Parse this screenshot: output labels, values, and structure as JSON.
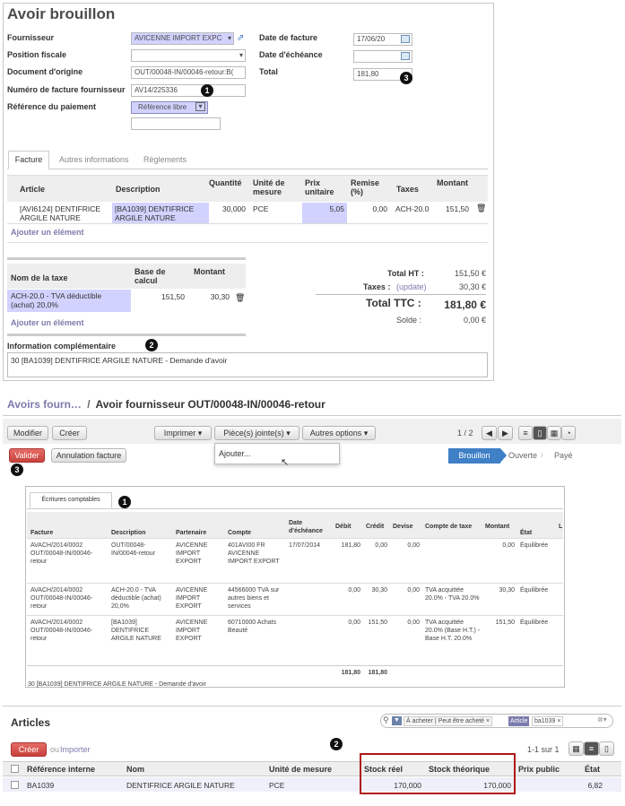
{
  "panel1": {
    "title": "Avoir brouillon",
    "labels": {
      "supplier": "Fournisseur",
      "fiscal": "Position fiscale",
      "origin": "Document d'origine",
      "supplier_invoice_no": "Numéro de facture fournisseur",
      "payment_ref": "Référence du paiement",
      "invoice_date": "Date de facture",
      "due_date": "Date d'échéance",
      "total": "Total"
    },
    "values": {
      "supplier": "AVICENNE IMPORT EXPC",
      "fiscal": "",
      "origin": "OUT/00048-IN/00046-retour:B(",
      "supplier_invoice_no": "AV14/225336",
      "payment_ref": "Référence libre",
      "invoice_date": "17/06/20",
      "due_date": "",
      "total": "181,80"
    },
    "badges": {
      "b1": "1",
      "b2": "2",
      "b3": "3"
    },
    "tabs": [
      "Facture",
      "Autres informations",
      "Règlements"
    ],
    "lines_headers": [
      "Article",
      "Description",
      "Quantité",
      "Unité de mesure",
      "Prix unitaire",
      "Remise (%)",
      "Taxes",
      "Montant"
    ],
    "line": {
      "article": "[AVI6124] DENTIFRICE ARGILE NATURE",
      "description": "[BA1039] DENTIFRICE ARGILE NATURE",
      "qty": "30,000",
      "uom": "PCE",
      "price": "5,05",
      "discount": "0,00",
      "taxes": "ACH-20.0",
      "amount": "151,50"
    },
    "add_item": "Ajouter un élément",
    "tax_headers": [
      "Nom de la taxe",
      "Base de calcul",
      "Montant"
    ],
    "tax_line": {
      "name": "ACH-20.0 - TVA déductible (achat) 20,0%",
      "base": "151,50",
      "amount": "30,30"
    },
    "totals": {
      "ht_label": "Total HT :",
      "ht": "151,50 €",
      "taxes_label": "Taxes :",
      "update": "(update)",
      "taxes": "30,30 €",
      "ttc_label": "Total TTC :",
      "ttc": "181,80 €",
      "solde_label": "Solde :",
      "solde": "0,00 €"
    },
    "info_label": "Information complémentaire",
    "info_text": "30 [BA1039] DENTIFRICE ARGILE NATURE - Demande d'avoir"
  },
  "panel2": {
    "breadcrumb_parent": "Avoirs fourn…",
    "breadcrumb_sep": "/",
    "breadcrumb_current": "Avoir fournisseur OUT/00048-IN/00046-retour",
    "buttons": {
      "modify": "Modifier",
      "create": "Créer",
      "print": "Imprimer ▾",
      "attachments": "Pièce(s) jointe(s) ▾",
      "other": "Autres options ▾"
    },
    "pager": "1 / 2",
    "validate": "Valider",
    "cancel": "Annulation facture",
    "dropdown_item": "Ajouter...",
    "status": [
      "Brouillon",
      "Ouverte",
      "Payé"
    ]
  },
  "panel3": {
    "tab": "Écritures comptables",
    "headers": [
      "Facture",
      "Description",
      "Partenaire",
      "Compte",
      "Date d'échéance",
      "Débit",
      "Crédit",
      "Devise",
      "Compte de taxe",
      "Montant",
      "État",
      "L"
    ],
    "rows": [
      [
        "AVACH/2014/0002 OUT/00048-IN/00046-retour",
        "OUT/00048-IN/00046-retour",
        "AVICENNE IMPORT EXPORT",
        "401AVI00 FR AVICENNE IMPORT EXPORT",
        "17/07/2014",
        "181,80",
        "0,00",
        "0,00",
        "",
        "0,00",
        "Équilibrée"
      ],
      [
        "AVACH/2014/0002 OUT/00048-IN/00046-retour",
        "ACH-20.0 - TVA déductible (achat) 20,0%",
        "AVICENNE IMPORT EXPORT",
        "44566000 TVA sur autres biens et services",
        "",
        "0,00",
        "30,30",
        "0,00",
        "TVA acquittée 20.0% - TVA 20.0%",
        "30,30",
        "Équilibrée"
      ],
      [
        "AVACH/2014/0002 OUT/00048-IN/00046-retour",
        "[BA1039] DENTIFRICE ARGILE NATURE",
        "AVICENNE IMPORT EXPORT",
        "60710000 Achats Beauté",
        "",
        "0,00",
        "151,50",
        "0,00",
        "TVA acquittée 20.0% (Base H.T.) - Base H.T. 20.0%",
        "151,50",
        "Équilibrée"
      ]
    ],
    "total_debit": "181,80",
    "total_credit": "181,80",
    "footer": "30 [BA1039] DENTIFRICE ARGILE NATURE - Demande d'avoir"
  },
  "panel4": {
    "title": "Articles",
    "facet1_value": "À acheter",
    "facet1_rest": "Peut être acheté",
    "facet2_label": "Article",
    "facet2_value": "ba1039",
    "create": "Créer",
    "or": "ou",
    "import": "Importer",
    "pager": "1-1 sur 1",
    "headers": [
      "Référence interne",
      "Nom",
      "Unité de mesure",
      "Stock réel",
      "Stock théorique",
      "Prix public",
      "État"
    ],
    "row": {
      "ref": "BA1039",
      "name": "DENTIFRICE ARGILE NATURE",
      "uom": "PCE",
      "stock_real": "170,000",
      "stock_theoretical": "170,000",
      "price": "6,82"
    }
  },
  "colors": {
    "accent": "#7c7bad",
    "required": "#d2d2ff",
    "validate": "#dc5f59",
    "status_active": "#3f80c6",
    "highlight_box": "#b01616"
  },
  "icons": [
    "external-link-icon",
    "calendar-icon",
    "trash-icon",
    "search-icon",
    "filter-icon",
    "list-view-icon",
    "form-view-icon",
    "calendar-view-icon",
    "graph-view-icon",
    "prev-icon",
    "next-icon",
    "cursor-icon"
  ]
}
